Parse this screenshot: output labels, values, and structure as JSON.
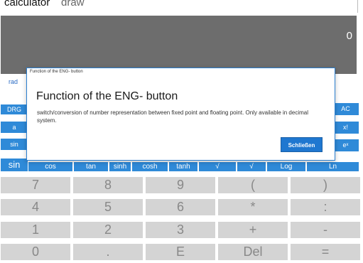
{
  "tabs": {
    "calculator": "calculator",
    "draw": "draw"
  },
  "display": {
    "value": "0"
  },
  "mode": {
    "angle_label": "rad"
  },
  "left_buttons": {
    "drg": "DRG",
    "a": "a",
    "sin": "sin",
    "sin_main": "sin"
  },
  "right_buttons": {
    "ac": "AC",
    "fact": "x!",
    "exp": "eˣ"
  },
  "function_row": [
    "cos",
    "tan",
    "sinh",
    "cosh",
    "tanh",
    "√",
    "√",
    "Log",
    "Ln"
  ],
  "keypad": {
    "rows": [
      [
        "7",
        "8",
        "9",
        "(",
        ")"
      ],
      [
        "4",
        "5",
        "6",
        "*",
        ":"
      ],
      [
        "1",
        "2",
        "3",
        "+",
        "-"
      ],
      [
        "0",
        ".",
        "E",
        "Del",
        "="
      ]
    ]
  },
  "dialog": {
    "caption": "Function of the ENG- button",
    "title": "Function of the ENG- button",
    "body": "switch/conversion of number representation between fixed point and floating point. Only available in decimal system.",
    "close_label": "Schließen",
    "accent_color": "#2b7fd0"
  }
}
